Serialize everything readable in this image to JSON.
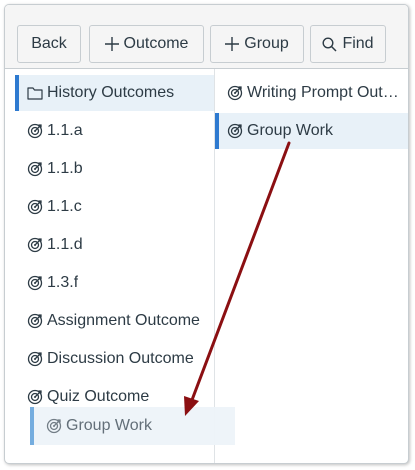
{
  "toolbar": {
    "back_label": "Back",
    "outcome_label": "Outcome",
    "group_label": "Group",
    "find_label": "Find"
  },
  "left_column": {
    "items": [
      {
        "label": "History Outcomes",
        "icon": "folder-icon",
        "selected": true
      },
      {
        "label": "1.1.a",
        "icon": "outcome-icon"
      },
      {
        "label": "1.1.b",
        "icon": "outcome-icon"
      },
      {
        "label": "1.1.c",
        "icon": "outcome-icon"
      },
      {
        "label": "1.1.d",
        "icon": "outcome-icon"
      },
      {
        "label": "1.3.f",
        "icon": "outcome-icon"
      },
      {
        "label": "Assignment Outcome",
        "icon": "outcome-icon"
      },
      {
        "label": "Discussion Outcome",
        "icon": "outcome-icon"
      },
      {
        "label": "Quiz Outcome",
        "icon": "outcome-icon"
      }
    ]
  },
  "right_column": {
    "items": [
      {
        "label": "Writing Prompt Out…",
        "icon": "outcome-icon"
      },
      {
        "label": "Group Work",
        "icon": "outcome-icon",
        "selected": true
      }
    ]
  },
  "drag_ghost": {
    "label": "Group Work",
    "icon": "outcome-icon"
  },
  "colors": {
    "accent": "#2e7ad0",
    "arrow": "#8b0f12",
    "selected_bg": "#e8f1f8"
  }
}
